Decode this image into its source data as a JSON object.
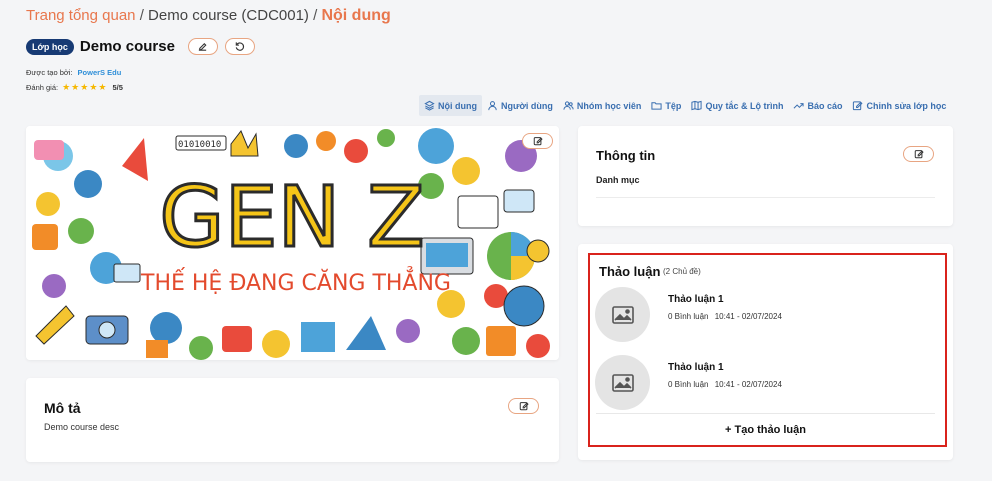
{
  "breadcrumb": {
    "home": "Trang tổng quan",
    "separator": "/",
    "course": "Demo course (CDC001)",
    "current": "Nội dung"
  },
  "course": {
    "badge": "Lớp học",
    "title": "Demo course",
    "created_by_label": "Được tạo bởi:",
    "created_by": "PowerS Edu",
    "rating_label": "Đánh giá:",
    "stars": "★★★★★",
    "rating": "5/5"
  },
  "tabs": [
    {
      "label": "Nội dung",
      "icon": "layers-icon"
    },
    {
      "label": "Người dùng",
      "icon": "user-icon"
    },
    {
      "label": "Nhóm học viên",
      "icon": "users-icon"
    },
    {
      "label": "Tệp",
      "icon": "folder-icon"
    },
    {
      "label": "Quy tắc & Lộ trình",
      "icon": "map-icon"
    },
    {
      "label": "Báo cáo",
      "icon": "trend-icon"
    },
    {
      "label": "Chỉnh sửa lớp học",
      "icon": "edit-icon"
    }
  ],
  "hero": {
    "title": "GEN Z",
    "subtitle": "THẾ HỆ ĐANG CĂNG THẲNG"
  },
  "description": {
    "heading": "Mô tả",
    "text": "Demo course desc"
  },
  "info": {
    "heading": "Thông tin",
    "category_label": "Danh mục"
  },
  "discussion": {
    "heading": "Thảo luận",
    "count": "(2 Chủ đề)",
    "topics": [
      {
        "title": "Thảo luận 1",
        "comments": "0 Bình luận",
        "time": "10:41 - 02/07/2024"
      },
      {
        "title": "Thảo luận 1",
        "comments": "0 Bình luận",
        "time": "10:41 - 02/07/2024"
      }
    ],
    "create_label": "+ Tạo thảo luận"
  },
  "colors": {
    "accent": "#e8774d",
    "badge": "#173a74",
    "link": "#2f8fd8",
    "tab": "#3a6fb0",
    "highlight": "#d9231c"
  }
}
